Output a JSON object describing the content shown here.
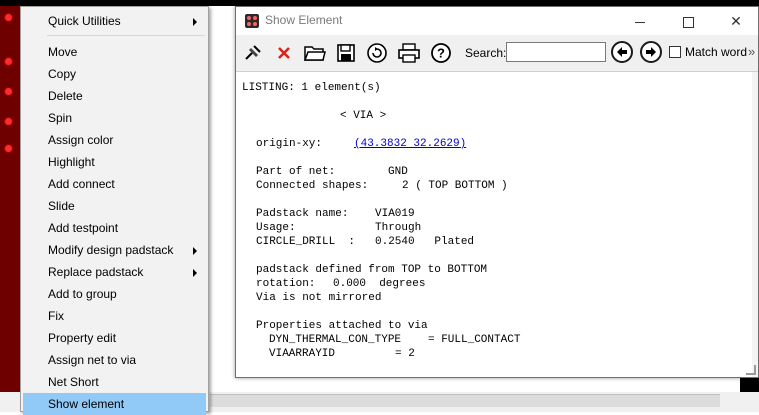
{
  "context_menu": {
    "items": [
      {
        "label": "Quick Utilities",
        "submenu": true
      },
      {
        "label": "Move"
      },
      {
        "label": "Copy"
      },
      {
        "label": "Delete"
      },
      {
        "label": "Spin"
      },
      {
        "label": "Assign color"
      },
      {
        "label": "Highlight"
      },
      {
        "label": "Add connect"
      },
      {
        "label": "Slide"
      },
      {
        "label": "Add testpoint"
      },
      {
        "label": "Modify design padstack",
        "submenu": true
      },
      {
        "label": "Replace padstack",
        "submenu": true
      },
      {
        "label": "Add to group"
      },
      {
        "label": "Fix"
      },
      {
        "label": "Property edit"
      },
      {
        "label": "Assign net to via"
      },
      {
        "label": "Net Short"
      },
      {
        "label": "Show element",
        "highlighted": true
      }
    ]
  },
  "window": {
    "title": "Show Element",
    "controls": {
      "minimize": "minimize",
      "maximize": "maximize",
      "close": "✕"
    }
  },
  "toolbar": {
    "icons": [
      "pin-icon",
      "close-x-icon",
      "folder-open-icon",
      "save-icon",
      "refresh-icon",
      "print-icon",
      "help-icon"
    ],
    "search_label": "Search:",
    "search_value": "",
    "prev_icon": "arrow-left-icon",
    "next_icon": "arrow-right-icon",
    "match_word_label": "Match word",
    "match_word_checked": false,
    "overflow": "»"
  },
  "listing": {
    "header": "LISTING: 1 element(s)",
    "element_type": "< VIA >",
    "origin_label": "origin-xy:",
    "origin_value": "(43.3832 32.2629)",
    "part_of_net_label": "Part of net:",
    "part_of_net_value": "GND",
    "connected_shapes_label": "Connected shapes:",
    "connected_shapes_value": "2 ( TOP BOTTOM )",
    "padstack_name_label": "Padstack name:",
    "padstack_name_value": "VIA019",
    "usage_label": "Usage:",
    "usage_value": "Through",
    "drill_label": "CIRCLE_DRILL  :",
    "drill_value": "0.2540   Plated",
    "padstack_defined": "padstack defined from TOP to BOTTOM",
    "rotation_label": "rotation:",
    "rotation_value": "0.000  degrees",
    "mirror_status": "Via is not mirrored",
    "properties_header": "Properties attached to via",
    "prop1_name": "DYN_THERMAL_CON_TYPE",
    "prop1_value": "= FULL_CONTACT",
    "prop2_name": "VIAARRAYID",
    "prop2_value": "= 2"
  },
  "colors": {
    "menu_highlight": "#91c9f7",
    "canvas_background": "#6e0000",
    "link": "#0000cc"
  }
}
